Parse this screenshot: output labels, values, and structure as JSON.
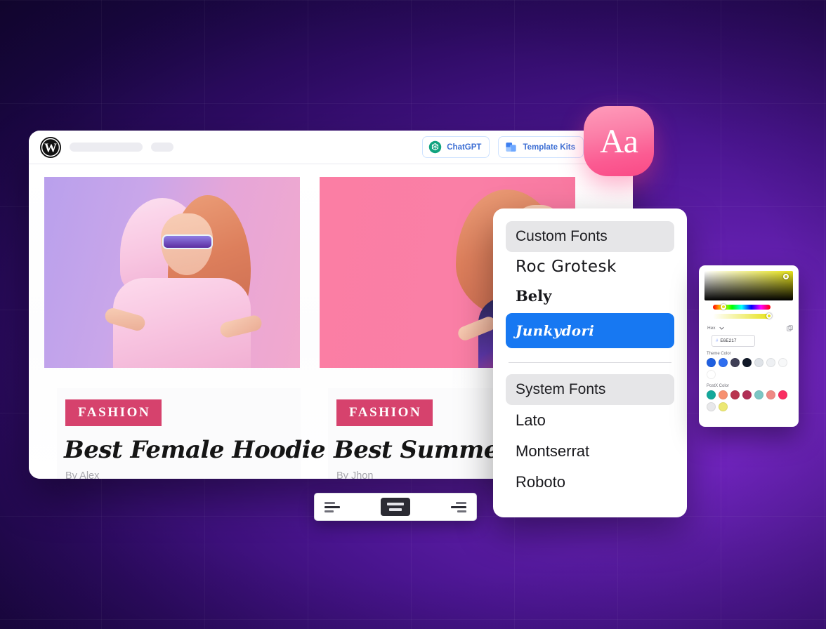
{
  "background": {
    "grid": true,
    "base_color": "#1a0640",
    "accent_color": "#7b27c9"
  },
  "browser_window": {
    "topbar": {
      "logo_icon": "wordpress-logo-icon",
      "placeholder_a": "",
      "placeholder_b": "",
      "placeholder_c": "",
      "buttons": [
        {
          "label": "ChatGPT",
          "icon": "chatgpt-icon",
          "color": "#3d6fd4"
        },
        {
          "label": "Template Kits",
          "icon": "template-kits-icon",
          "color": "#3d6fd4"
        }
      ]
    },
    "cards": [
      {
        "badge": "FASHION",
        "title": "Best Female Hoodie",
        "author": "By Alex",
        "badge_color": "#d6426d",
        "image_alt": "woman-in-pink-hoodie-with-sunglasses"
      },
      {
        "badge": "FASHION",
        "title": "Best Summer",
        "author": "By Jhon",
        "badge_color": "#d6426d",
        "image_alt": "woman-with-curly-hair-on-pink-background"
      }
    ]
  },
  "aa_badge": {
    "label": "Aa",
    "color": "#fb5b92"
  },
  "fonts_panel": {
    "custom_heading": "Custom Fonts",
    "custom_fonts": [
      "Roc Grotesk",
      "Bely",
      "Junkydori"
    ],
    "selected_font": "Junkydori",
    "selected_color": "#1778f2",
    "system_heading": "System Fonts",
    "system_fonts": [
      "Lato",
      "Montserrat",
      "Roboto"
    ]
  },
  "color_picker": {
    "format_label": "Hex",
    "dropdown_icon": "chevron-down-icon",
    "copy_icon": "copy-icon",
    "hash": "#",
    "hex_value": "E6E217",
    "current_color": "#E6E217",
    "theme_label": "Theme Color",
    "theme_swatches": [
      "#1f5fe0",
      "#2f6ef0",
      "#3f3f56",
      "#111827",
      "#dfe3e8",
      "#eef0f3",
      "#f7f8f9",
      "#ffffff"
    ],
    "postx_label": "PostX Color",
    "postx_swatches": [
      "#14a89b",
      "#f79070",
      "#b9344f",
      "#b12f56",
      "#7bc6c4",
      "#ef8a85",
      "#fa2e62",
      "#e8e8ea",
      "#ece873"
    ]
  },
  "align_toolbar": {
    "items": [
      {
        "name": "align-left",
        "active": false
      },
      {
        "name": "align-center",
        "active": true
      },
      {
        "name": "align-right",
        "active": false
      }
    ]
  }
}
